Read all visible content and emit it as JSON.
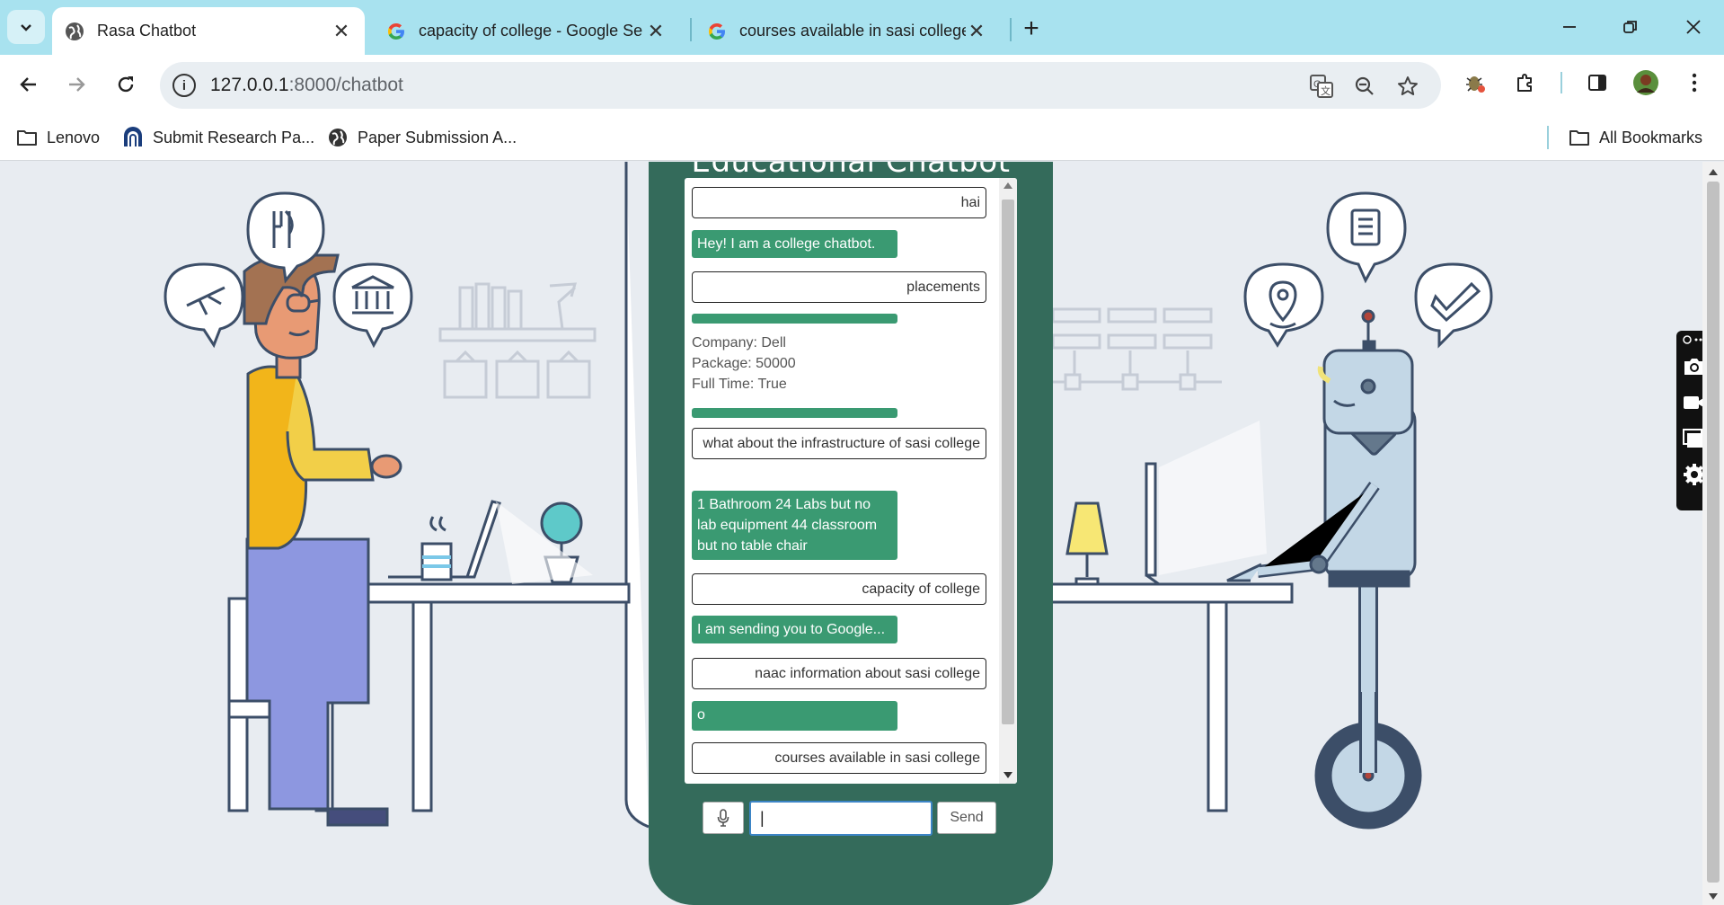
{
  "browser": {
    "tabs": [
      {
        "title": "Rasa Chatbot",
        "favicon": "globe-icon",
        "active": true
      },
      {
        "title": "capacity of college - Google Se",
        "favicon": "google-icon",
        "active": false
      },
      {
        "title": "courses available in sasi college",
        "favicon": "google-icon",
        "active": false
      }
    ],
    "url_host": "127.0.0.1",
    "url_path": ":8000/chatbot",
    "bookmarks": [
      {
        "label": "Lenovo",
        "icon": "folder-icon"
      },
      {
        "label": "Submit Research Pa...",
        "icon": "research-site-icon"
      },
      {
        "label": "Paper Submission A...",
        "icon": "globe-icon"
      }
    ],
    "all_bookmarks_label": "All Bookmarks"
  },
  "chat": {
    "title": "Educational Chatbot",
    "messages": [
      {
        "sender": "user",
        "text": "hai"
      },
      {
        "sender": "bot",
        "text": "Hey! I am a college chatbot."
      },
      {
        "sender": "user",
        "text": "placements"
      },
      {
        "sender": "bot",
        "lines": [
          "Company: Dell",
          "Package: 50000",
          "Full Time: True"
        ]
      },
      {
        "sender": "user",
        "text": "what about the infrastructure of sasi college"
      },
      {
        "sender": "bot",
        "text": "1 Bathroom 24 Labs but no lab equipment 44 classroom but no table chair"
      },
      {
        "sender": "user",
        "text": "capacity of college"
      },
      {
        "sender": "bot",
        "text": "I am sending you to Google..."
      },
      {
        "sender": "user",
        "text": "naac information about sasi college"
      },
      {
        "sender": "bot",
        "text": "o"
      },
      {
        "sender": "user",
        "text": "courses available in sasi college"
      }
    ],
    "input_value": "|",
    "send_label": "Send"
  },
  "colors": {
    "tabstrip": "#a8e2ef",
    "chat_panel": "#346b5b",
    "bot_bubble": "#3a9a72"
  }
}
